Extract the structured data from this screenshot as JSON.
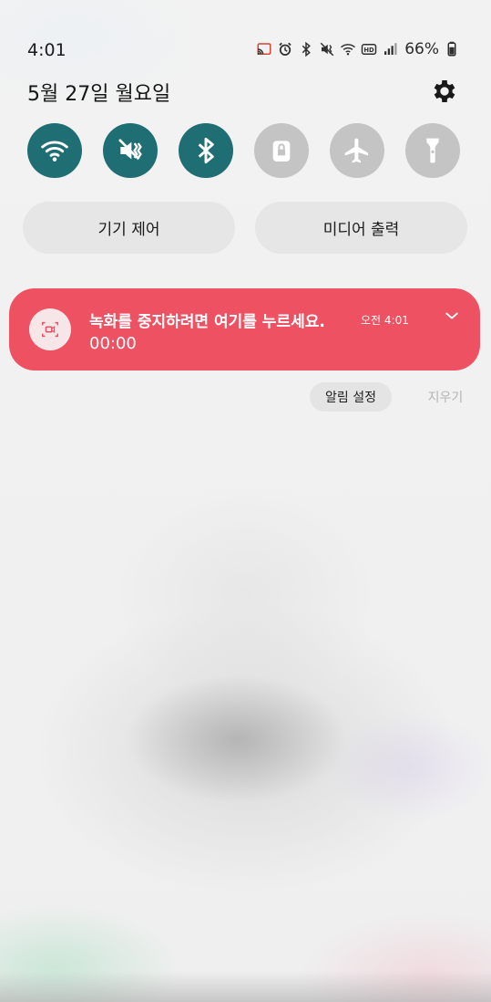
{
  "status_bar": {
    "time": "4:01",
    "battery_percent": "66%",
    "icons": [
      "cast-icon",
      "alarm-icon",
      "bluetooth-icon",
      "vibrate-icon",
      "wifi-icon",
      "hd-icon",
      "signal-icon",
      "battery-icon"
    ]
  },
  "header": {
    "date": "5월 27일 월요일",
    "settings_icon": "gear-icon"
  },
  "quick_settings": [
    {
      "name": "wifi",
      "icon": "wifi-icon",
      "active": true
    },
    {
      "name": "vibrate",
      "icon": "vibrate-icon",
      "active": true
    },
    {
      "name": "bluetooth",
      "icon": "bluetooth-icon",
      "active": true
    },
    {
      "name": "lock-screen",
      "icon": "lock-icon",
      "active": false
    },
    {
      "name": "airplane",
      "icon": "airplane-icon",
      "active": false
    },
    {
      "name": "flashlight",
      "icon": "flashlight-icon",
      "active": false
    }
  ],
  "buttons": {
    "device_control": "기기 제어",
    "media_output": "미디어 출력"
  },
  "notification": {
    "title": "녹화를 중지하려면 여기를 누르세요.",
    "time": "오전 4:01",
    "subtitle": "00:00",
    "icon": "screen-record-icon",
    "color": "#ee5161"
  },
  "footer_actions": {
    "notification_settings": "알림 설정",
    "clear": "지우기"
  },
  "colors": {
    "active_tile": "#1f6e73",
    "inactive_tile": "#c4c4c4"
  }
}
